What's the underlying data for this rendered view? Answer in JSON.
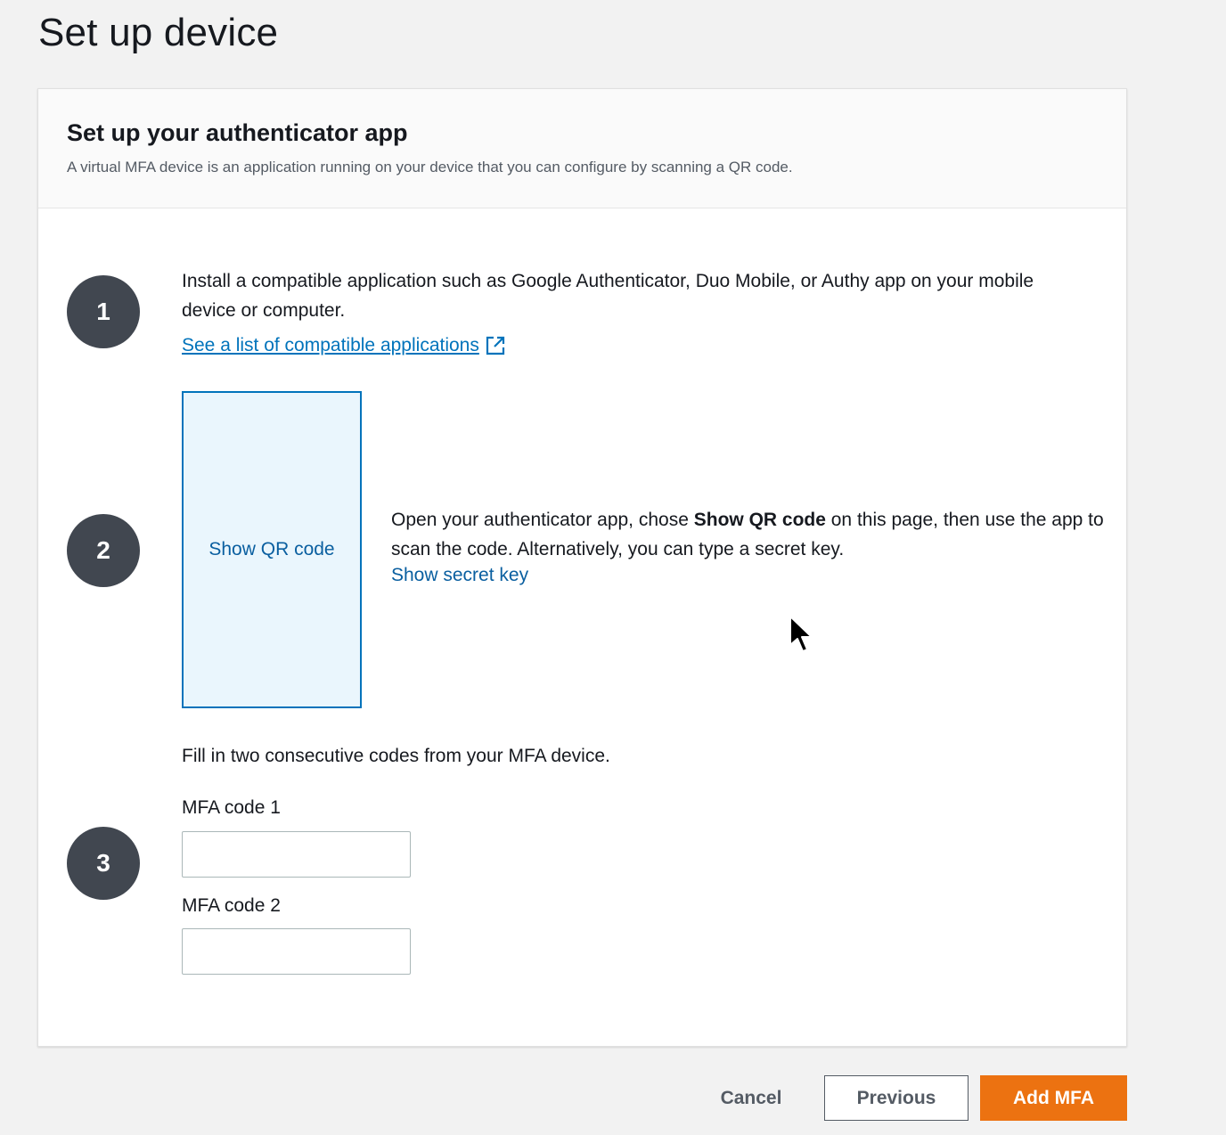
{
  "page": {
    "title": "Set up device"
  },
  "panel": {
    "title": "Set up your authenticator app",
    "description": "A virtual MFA device is an application running on your device that you can configure by scanning a QR code."
  },
  "steps": [
    {
      "number": "1",
      "text": "Install a compatible application such as Google Authenticator, Duo Mobile, or Authy app on your mobile device or computer.",
      "link_label": "See a list of compatible applications"
    },
    {
      "number": "2",
      "qr_button_label": "Show QR code",
      "text_before": "Open your authenticator app, chose ",
      "text_bold": "Show QR code",
      "text_after": " on this page, then use the app to scan the code. Alternatively, you can type a secret key.",
      "link_label": "Show secret key"
    },
    {
      "number": "3",
      "intro": "Fill in two consecutive codes from your MFA device.",
      "field1_label": "MFA code 1",
      "field1_value": "",
      "field2_label": "MFA code 2",
      "field2_value": ""
    }
  ],
  "actions": {
    "cancel_label": "Cancel",
    "previous_label": "Previous",
    "add_label": "Add MFA"
  },
  "colors": {
    "primary": "#ec7211",
    "link": "#0073bb",
    "step_circle": "#414750",
    "qr_background": "#eaf6fd"
  },
  "icons": {
    "external_link": "external-link-icon",
    "cursor": "mouse-pointer-icon"
  }
}
